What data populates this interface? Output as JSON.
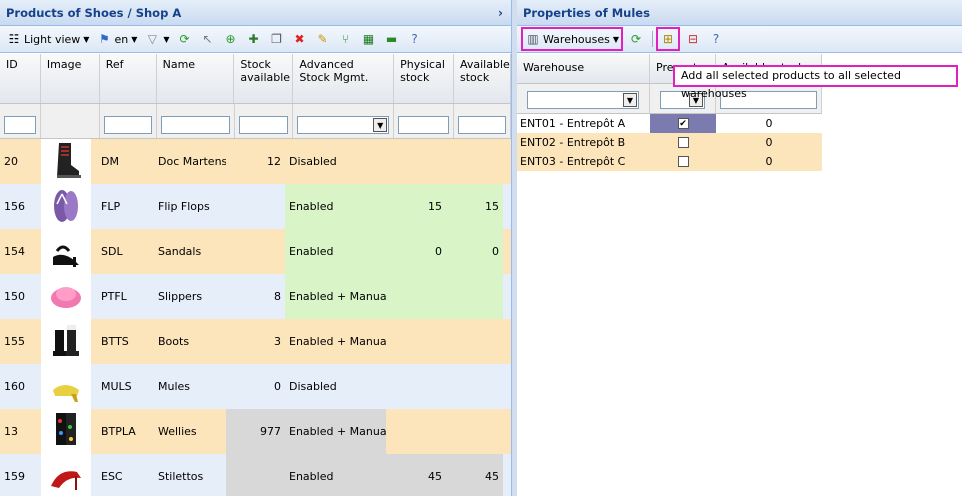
{
  "left": {
    "title": "Products of Shoes / Shop A",
    "collapse_glyph": "›",
    "toolbar": {
      "view_label": "Light view",
      "lang_label": "en"
    },
    "columns": [
      "ID",
      "Image",
      "Ref",
      "Name",
      "Stock available",
      "Advanced Stock Mgmt.",
      "Physical stock",
      "Available stock"
    ],
    "rows": [
      {
        "id": "20",
        "ref": "DM",
        "name": "Doc Martens",
        "stock": "12",
        "asm": "Disabled",
        "phys": "",
        "avail": "",
        "icon": "boot-thumb"
      },
      {
        "id": "156",
        "ref": "FLP",
        "name": "Flip Flops",
        "stock": "",
        "asm": "Enabled",
        "phys": "15",
        "avail": "15",
        "icon": "flipflop-thumb"
      },
      {
        "id": "154",
        "ref": "SDL",
        "name": "Sandals",
        "stock": "",
        "asm": "Enabled",
        "phys": "0",
        "avail": "0",
        "icon": "sandal-thumb"
      },
      {
        "id": "150",
        "ref": "PTFL",
        "name": "Slippers",
        "stock": "8",
        "asm": "Enabled + Manual M",
        "phys": "",
        "avail": "",
        "icon": "slipper-thumb"
      },
      {
        "id": "155",
        "ref": "BTTS",
        "name": "Boots",
        "stock": "3",
        "asm": "Enabled + Manual M",
        "phys": "",
        "avail": "",
        "icon": "boots-thumb"
      },
      {
        "id": "160",
        "ref": "MULS",
        "name": "Mules",
        "stock": "0",
        "asm": "Disabled",
        "phys": "",
        "avail": "",
        "icon": "mule-thumb"
      },
      {
        "id": "13",
        "ref": "BTPLA",
        "name": "Wellies",
        "stock": "977",
        "asm": "Enabled + Manual M",
        "phys": "",
        "avail": "",
        "icon": "wellies-thumb"
      },
      {
        "id": "159",
        "ref": "ESC",
        "name": "Stilettos",
        "stock": "",
        "asm": "Enabled",
        "phys": "45",
        "avail": "45",
        "icon": "stiletto-thumb"
      }
    ]
  },
  "right": {
    "title": "Properties of Mules",
    "toolbar": {
      "warehouses_label": "Warehouses"
    },
    "tooltip": "Add all selected products to all selected warehouses",
    "columns": [
      "Warehouse",
      "Present",
      "Available stock"
    ],
    "rows": [
      {
        "warehouse": "ENT01 - Entrepôt A",
        "present": true,
        "avail": "0"
      },
      {
        "warehouse": "ENT02 - Entrepôt B",
        "present": false,
        "avail": "0"
      },
      {
        "warehouse": "ENT03 - Entrepôt C",
        "present": false,
        "avail": "0"
      }
    ]
  },
  "colors": {
    "accent": "#15428b",
    "highlight": "#e020c0",
    "row_orange": "#fde5bb",
    "row_blue": "#e6eefa",
    "enabled_green": "#d9f5c7",
    "selected_cell": "#7b7bb0"
  }
}
